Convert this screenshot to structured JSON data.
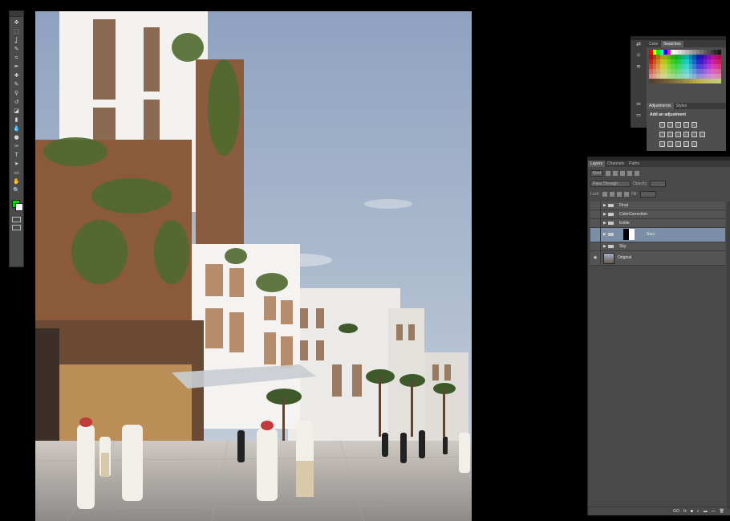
{
  "tools": {
    "icons": [
      "move-tool",
      "marquee-tool",
      "lasso-tool",
      "quick-select-tool",
      "crop-tool",
      "eyedropper-tool",
      "healing-brush-tool",
      "brush-tool",
      "clone-stamp-tool",
      "history-brush-tool",
      "eraser-tool",
      "gradient-tool",
      "blur-tool",
      "dodge-tool",
      "pen-tool",
      "type-tool",
      "path-select-tool",
      "shape-tool",
      "hand-tool",
      "zoom-tool"
    ],
    "glyphs": [
      "✥",
      "⬚",
      "ʆ",
      "✎",
      "⌗",
      "✒",
      "✚",
      "✎",
      "⚲",
      "↺",
      "◪",
      "▮",
      "💧",
      "●",
      "✑",
      "T",
      "➤",
      "▭",
      "✋",
      "🔍"
    ],
    "foreground_color": "#00e000",
    "background_color": "#ffffff"
  },
  "swatches_panel": {
    "tabs": [
      "Color",
      "Swatches"
    ],
    "active_tab": "Swatches",
    "side_icons": [
      "⇄",
      "☼",
      "≋"
    ]
  },
  "adjustments_panel": {
    "tabs": [
      "Adjustments",
      "Styles"
    ],
    "active_tab": "Adjustments",
    "title": "Add an adjustment",
    "side_icons": [
      "⚌",
      "⚏"
    ]
  },
  "layers_panel": {
    "tabs": [
      "Layers",
      "Channels",
      "Paths"
    ],
    "active_tab": "Layers",
    "filter_label": "Kind",
    "blend_mode": "Pass Through",
    "opacity_label": "Opacity:",
    "opacity_value": "",
    "lock_label": "Lock:",
    "fill_label": "Fill:",
    "fill_value": "",
    "layers": [
      {
        "name": "Final",
        "type": "group"
      },
      {
        "name": "ColorCorrection",
        "type": "group"
      },
      {
        "name": "Entite",
        "type": "group"
      },
      {
        "name": "Bare",
        "type": "group",
        "selected": true
      },
      {
        "name": "Sky",
        "type": "group"
      },
      {
        "name": "Original",
        "type": "layer",
        "visible": true
      }
    ],
    "footer_icons": [
      "GO",
      "fx",
      "◙",
      "◐",
      "▬",
      "▭",
      "🗑"
    ]
  },
  "colors": {
    "app_bg": "#000000",
    "panel_bg": "#494949",
    "selection": "#7a8ea8",
    "foreground": "#00e000"
  }
}
